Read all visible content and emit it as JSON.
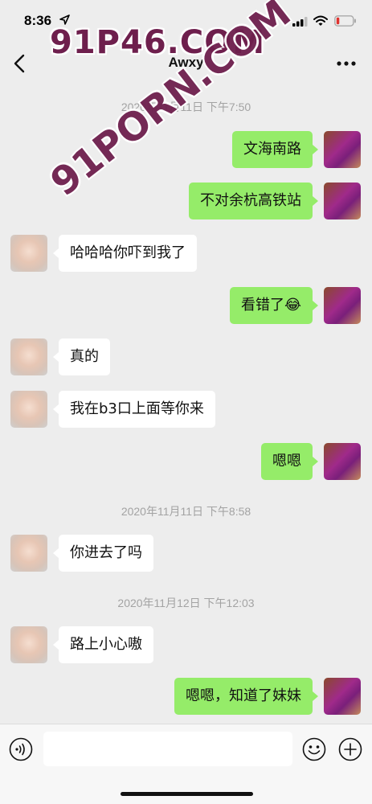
{
  "status_bar": {
    "time": "8:36"
  },
  "header": {
    "title": "Awxy"
  },
  "watermark": {
    "site": "91P46.COM",
    "diagonal": "91PORN.COM"
  },
  "timestamps": [
    "2020年11月11日 下午7:50",
    "2020年11月11日 下午8:58",
    "2020年11月12日 下午12:03"
  ],
  "messages": [
    {
      "sender": "self",
      "text": "文海南路"
    },
    {
      "sender": "self",
      "text": "不对余杭高铁站"
    },
    {
      "sender": "other",
      "text": "哈哈哈你吓到我了"
    },
    {
      "sender": "self",
      "text": "看错了😂"
    },
    {
      "sender": "other",
      "text": "真的"
    },
    {
      "sender": "other",
      "text": "我在b3口上面等你来"
    },
    {
      "sender": "self",
      "text": "嗯嗯"
    },
    {
      "sender": "other",
      "text": "你进去了吗"
    },
    {
      "sender": "other",
      "text": "路上小心嗷"
    },
    {
      "sender": "self",
      "text": "嗯嗯，知道了妹妹"
    }
  ],
  "icons": {
    "back": "chevron-left-icon",
    "more": "more-dots-icon",
    "voice": "voice-icon",
    "emoji": "emoji-icon",
    "add": "plus-icon"
  },
  "colors": {
    "background": "#ededed",
    "self_bubble": "#95ec69",
    "other_bubble": "#ffffff",
    "timestamp": "#a3a3a3",
    "watermark": "#6e1f4d"
  }
}
